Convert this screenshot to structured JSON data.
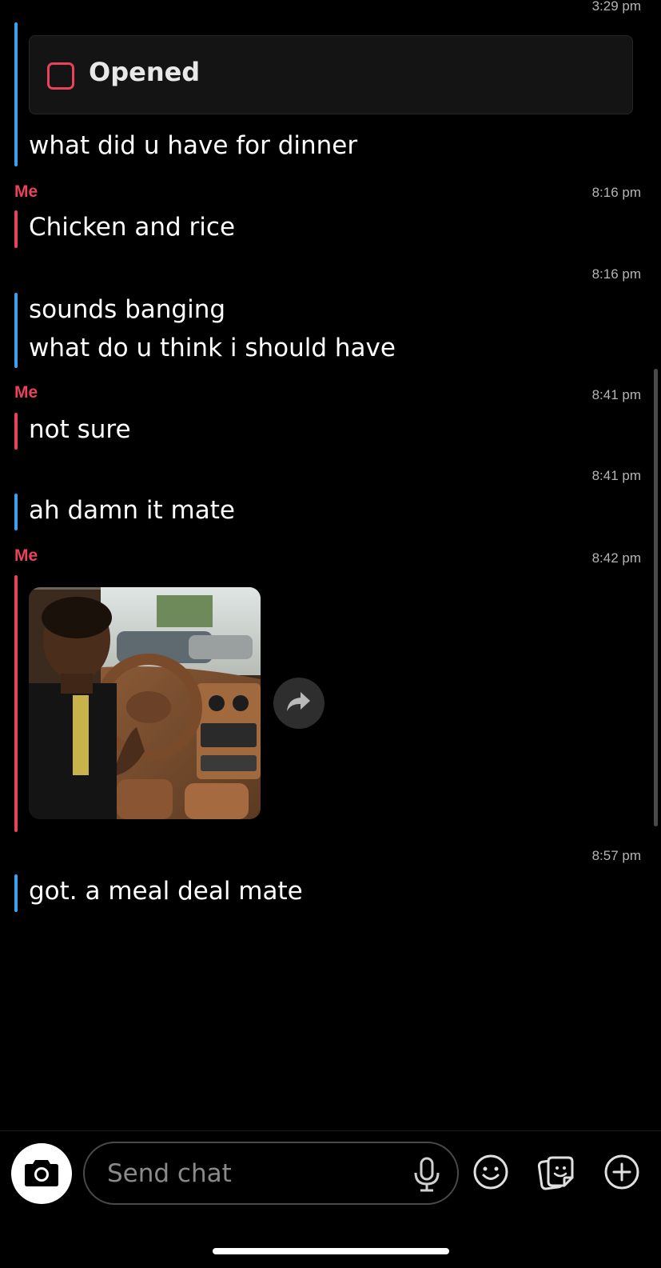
{
  "top_timestamp": "3:29 pm",
  "opened_status": "Opened",
  "messages": [
    {
      "sender": "",
      "time": "",
      "lines": [
        "what did u have for dinner"
      ]
    },
    {
      "sender": "Me",
      "time": "8:16 pm",
      "lines": [
        "Chicken and rice"
      ]
    },
    {
      "sender": "",
      "time": "8:16 pm",
      "lines": [
        "sounds banging",
        "what do u think i should have"
      ]
    },
    {
      "sender": "Me",
      "time": "8:41 pm",
      "lines": [
        "not sure"
      ]
    },
    {
      "sender": "",
      "time": "8:41 pm",
      "lines": [
        "ah damn it mate"
      ]
    },
    {
      "sender": "Me",
      "time": "8:42 pm",
      "lines": []
    },
    {
      "sender": "",
      "time": "8:57 pm",
      "lines": [
        "got. a meal deal mate"
      ]
    }
  ],
  "composer": {
    "placeholder": "Send chat"
  },
  "icons": {
    "camera": "camera-icon",
    "mic": "microphone-icon",
    "emoji": "emoji-icon",
    "stickers": "sticker-icon",
    "plus": "plus-icon",
    "share": "share-arrow-icon"
  },
  "colors": {
    "friend_accent": "#3aa2f0",
    "me_accent": "#e8435a",
    "background": "#000000"
  }
}
